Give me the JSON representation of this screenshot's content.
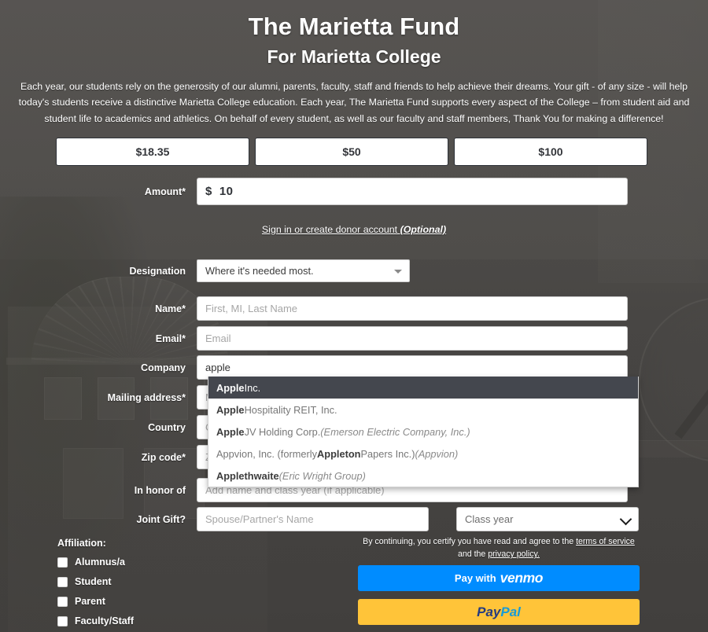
{
  "header": {
    "title": "The Marietta Fund",
    "subtitle": "For Marietta College",
    "intro": "Each year, our students rely on the generosity of our alumni, parents, faculty, staff and friends to help achieve their dreams. Your gift - of any size - will help today's students receive a distinctive Marietta College education. Each year, The Marietta Fund supports every aspect of the College – from student aid and student life to academics and athletics. On behalf of every student, as well as our faculty and staff members, Thank You for making a difference!"
  },
  "presets": [
    {
      "label": "$18.35"
    },
    {
      "label": "$50"
    },
    {
      "label": "$100"
    }
  ],
  "amount": {
    "label": "Amount*",
    "value": "$  10"
  },
  "signin": {
    "text": "Sign in or create donor account ",
    "optional": "(Optional)"
  },
  "designation": {
    "label": "Designation",
    "value": "Where it's needed most."
  },
  "fields": {
    "name": {
      "label": "Name*",
      "placeholder": "First, MI, Last Name",
      "value": ""
    },
    "email": {
      "label": "Email*",
      "placeholder": "Email",
      "value": ""
    },
    "company": {
      "label": "Company",
      "placeholder": "Company",
      "value": "apple"
    },
    "mailing": {
      "label": "Mailing address*",
      "placeholder": "Mailing address",
      "value": ""
    },
    "country": {
      "label": "Country",
      "placeholder": "Country",
      "value": ""
    },
    "zip": {
      "label": "Zip code*",
      "placeholder": "Zip code",
      "value": ""
    },
    "honor": {
      "label": "In honor of",
      "placeholder": "Add name and class year (if applicable)",
      "value": ""
    }
  },
  "autocomplete": {
    "query": "apple",
    "items": [
      {
        "match": "Apple",
        "rest": " Inc.",
        "note": "",
        "selected": true
      },
      {
        "match": "Apple",
        "rest": " Hospitality REIT, Inc.",
        "note": "",
        "selected": false
      },
      {
        "match": "Apple",
        "rest": " JV Holding Corp. ",
        "note": "(Emerson Electric Company, Inc.)",
        "selected": false
      },
      {
        "pre": "Appvion, Inc. (formerly ",
        "match": "Appleton",
        "rest": " Papers Inc.) ",
        "note": "(Appvion)",
        "selected": false
      },
      {
        "match": "Applethwaite",
        "rest": " ",
        "note": "(Eric Wright Group)",
        "selected": false
      }
    ]
  },
  "joint": {
    "label": "Joint Gift?",
    "name_placeholder": "Spouse/Partner's Name",
    "name_value": "",
    "classyear": "Class year"
  },
  "affiliation": {
    "title": "Affiliation:",
    "options": [
      {
        "label": "Alumnus/a",
        "checked": false
      },
      {
        "label": "Student",
        "checked": false
      },
      {
        "label": "Parent",
        "checked": false
      },
      {
        "label": "Faculty/Staff",
        "checked": false
      }
    ]
  },
  "terms": {
    "lead": "By continuing, you certify you have read and agree to the ",
    "tos": "terms of service",
    "mid": " and the ",
    "privacy": "privacy policy."
  },
  "payment": {
    "venmo_prefix": "Pay with",
    "venmo_logo": "venmo",
    "paypal_pay": "Pay",
    "paypal_pal": "Pal"
  },
  "colors": {
    "background": "#585654",
    "venmo_blue": "#008CFF",
    "paypal_yellow": "#FFC439",
    "paypal_navy": "#253B80",
    "paypal_lightblue": "#179BD7",
    "highlight_row": "#44474E"
  }
}
